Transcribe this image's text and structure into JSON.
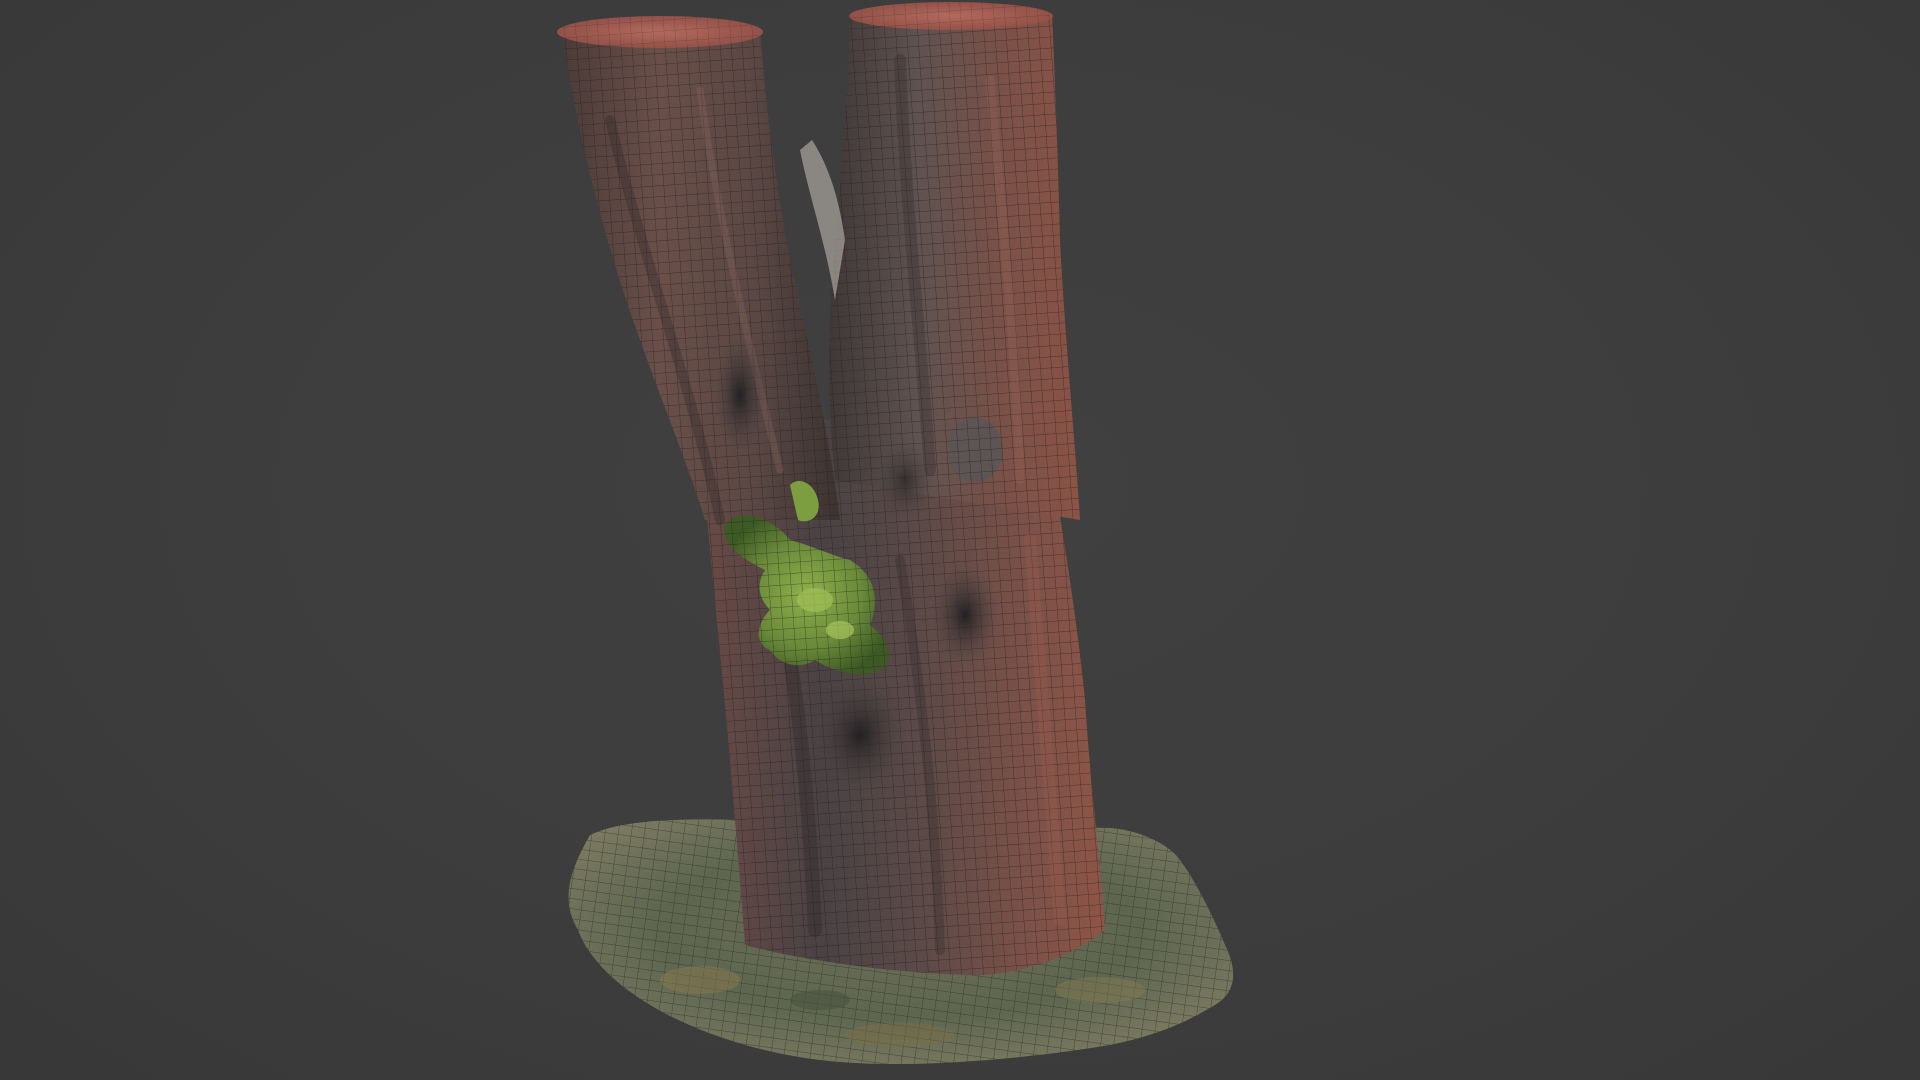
{
  "viewport": {
    "background_color": "#3d3d3d",
    "shading_mode": "textured-wireframe",
    "object": "tree-stump-scan"
  },
  "colors": {
    "bark_dark": "#3b3331",
    "bark_mid": "#5f4c47",
    "bark_warm": "#7b5148",
    "bark_light": "#8a6a62",
    "cut_surface": "#a35a4f",
    "moss": "#6b8a3a",
    "moss_dark": "#3e5a24",
    "ground_light": "#7a7a5c",
    "ground_dark": "#4e5443",
    "wire": "#1a1a1a"
  }
}
